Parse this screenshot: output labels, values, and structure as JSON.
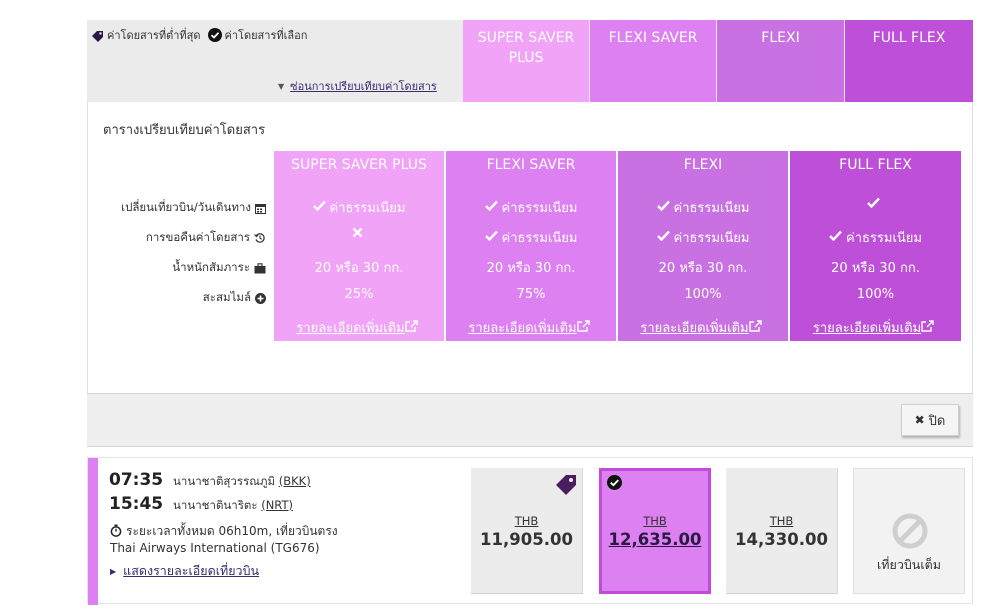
{
  "legend": {
    "lowest_fare": "ค่าโดยสารที่ต่ำที่สุด",
    "selected_fare": "ค่าโดยสารที่เลือก"
  },
  "compare_link": "ซ่อนการเปรียบเทียบค่าโดยสาร",
  "fare_headers": [
    "SUPER SAVER PLUS",
    "FLEXI SAVER",
    "FLEXI",
    "FULL FLEX"
  ],
  "comparison": {
    "title": "ตารางเปรียบเทียบค่าโดยสาร",
    "row_labels": {
      "change": "เปลี่ยนเที่ยวบิน/วันเดินทาง",
      "refund": "การขอคืนค่าโดยสาร",
      "baggage": "น้ำหนักสัมภาระ",
      "miles": "สะสมไมล์"
    },
    "columns": [
      {
        "name": "SUPER SAVER PLUS",
        "change": "ค่าธรรมเนียม",
        "refund": "",
        "baggage": "20 หรือ 30 กก.",
        "miles": "25%",
        "more": "รายละเอียดเพิ่มเติม"
      },
      {
        "name": "FLEXI SAVER",
        "change": "ค่าธรรมเนียม",
        "refund": "ค่าธรรมเนียม",
        "baggage": "20 หรือ 30 กก.",
        "miles": "75%",
        "more": "รายละเอียดเพิ่มเติม"
      },
      {
        "name": "FLEXI",
        "change": "ค่าธรรมเนียม",
        "refund": "ค่าธรรมเนียม",
        "baggage": "20 หรือ 30 กก.",
        "miles": "100%",
        "more": "รายละเอียดเพิ่มเติม"
      },
      {
        "name": "FULL FLEX",
        "change": "",
        "refund": "ค่าธรรมเนียม",
        "baggage": "20 หรือ 30 กก.",
        "miles": "100%",
        "more": "รายละเอียดเพิ่มเติม"
      }
    ]
  },
  "close_label": "ปิด",
  "flight": {
    "depart_time": "07:35",
    "depart_airport": "นานาชาติสุวรรณภูมิ",
    "depart_code": "(BKK)",
    "arrive_time": "15:45",
    "arrive_airport": "นานาชาตินาริตะ",
    "arrive_code": "(NRT)",
    "duration": "ระยะเวลาทั้งหมด 06h10m, เที่ยวบินตรง",
    "airline": "Thai Airways International (TG676)",
    "details_link": "แสดงรายละเอียดเที่ยวบิน"
  },
  "prices": [
    {
      "currency": "THB",
      "amount": "11,905.00"
    },
    {
      "currency": "THB",
      "amount": "12,635.00"
    },
    {
      "currency": "THB",
      "amount": "14,330.00"
    }
  ],
  "sold_out_label": "เที่ยวบินเต็ม",
  "colors": {
    "super_saver_plus": "#f0a3f7",
    "flexi_saver": "#dd80f1",
    "flexi": "#c971e2",
    "full_flex": "#be4fd8",
    "link": "#3a2a70"
  }
}
